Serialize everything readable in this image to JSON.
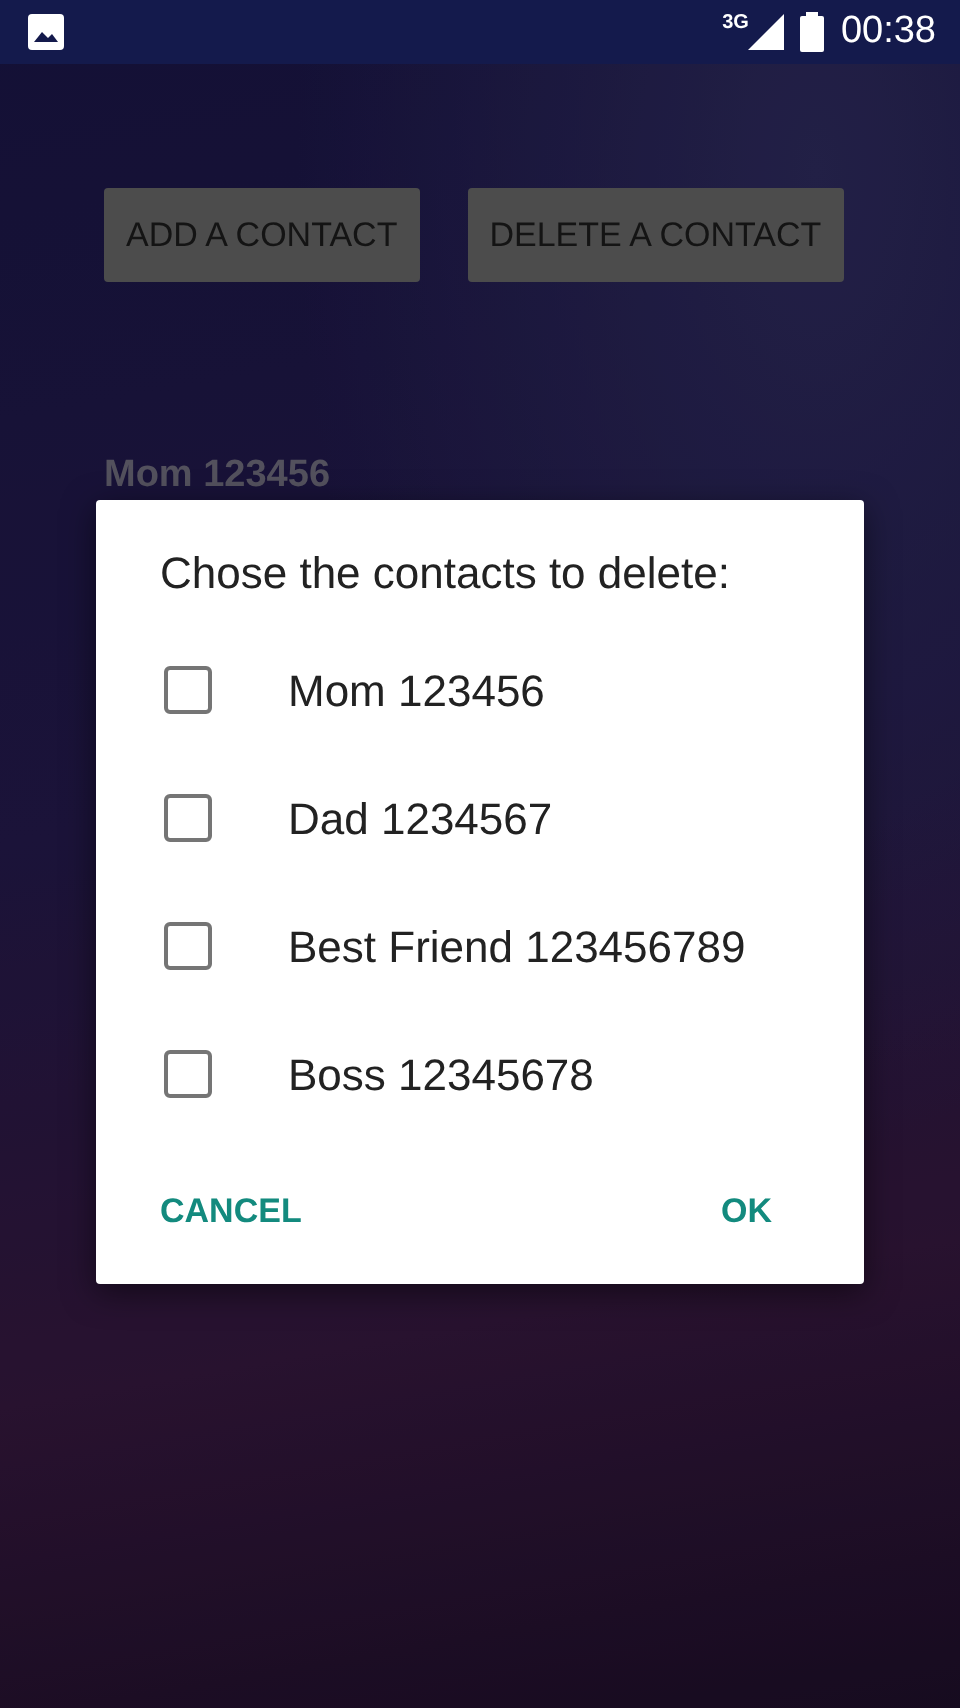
{
  "status_bar": {
    "network": "3G",
    "time": "00:38"
  },
  "buttons": [
    "ADD A CONTACT",
    "DELETE A CONTACT"
  ],
  "contacts": [
    "Mom 123456"
  ],
  "dialog": {
    "title": "Chose the contacts to delete:",
    "options": [
      {
        "label": "Mom 123456",
        "checked": false
      },
      {
        "label": "Dad 1234567",
        "checked": false
      },
      {
        "label": "Best Friend 123456789",
        "checked": false
      },
      {
        "label": "Boss 12345678",
        "checked": false
      }
    ],
    "actions": [
      "CANCEL",
      "OK"
    ]
  }
}
